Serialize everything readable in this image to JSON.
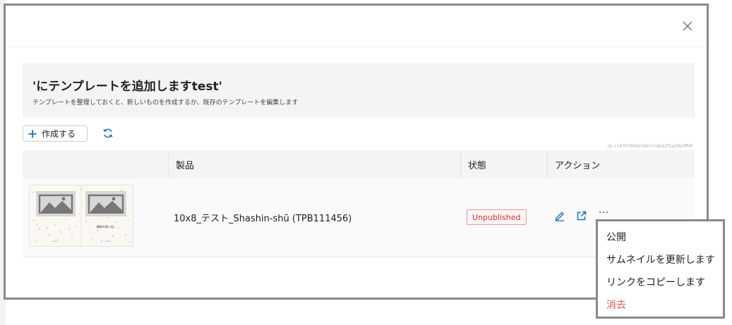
{
  "modal": {
    "title": "'にテンプレートを追加しますtest'",
    "subtitle": "テンプレートを整理しておくと、新しいものを作成するか、既存のテンプレートを編集します",
    "close_icon": "close-icon"
  },
  "toolbar": {
    "create_label": "作成する",
    "create_icon": "plus-icon",
    "refresh_icon": "refresh-icon",
    "id_text": "id: c14707966236b7ccde22f5a2ldc0ff4f"
  },
  "table": {
    "headers": [
      "",
      "製品",
      "状態",
      "アクション"
    ],
    "rows": [
      {
        "product": "10x8_テスト_Shashin-shū (TPB111456)",
        "status": "Unpublished",
        "thumb_text": "最新の思い出。"
      }
    ]
  },
  "menu": {
    "items": [
      "公開",
      "サムネイルを更新します",
      "リンクをコピーします",
      "消去"
    ]
  },
  "colors": {
    "accent": "#1f6fb5",
    "danger": "#e05a5a",
    "status_border": "#e79a9a"
  }
}
